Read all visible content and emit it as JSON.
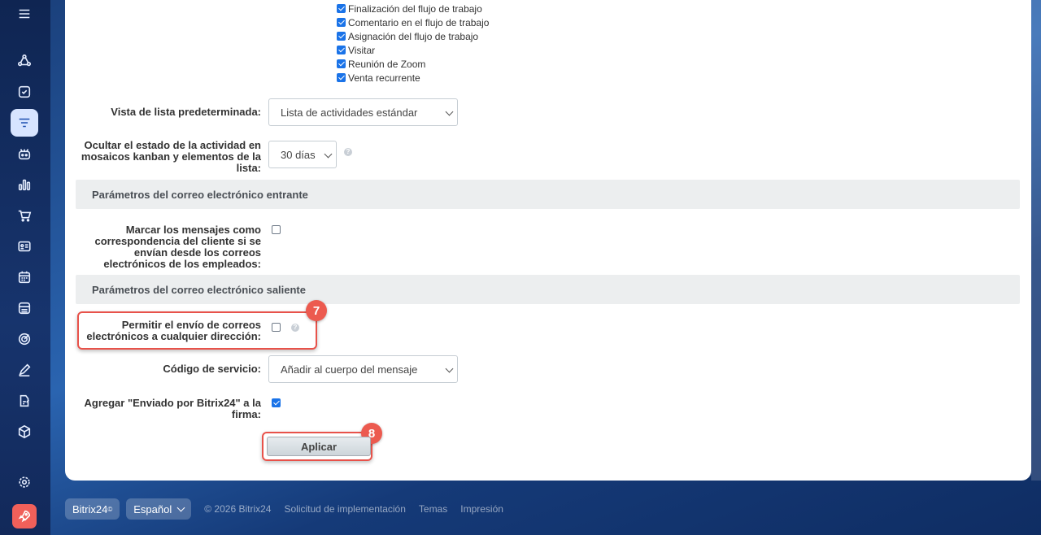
{
  "sidebar": {
    "icons": [
      "menu-icon",
      "share-network-icon",
      "checkbox-task-icon",
      "filter-funnel-icon",
      "robot-icon",
      "bar-chart-icon",
      "cart-icon",
      "contact-card-icon",
      "calendar-grid-icon",
      "store-icon",
      "target-icon",
      "pen-sign-icon",
      "document-edit-icon",
      "cube-icon",
      "settings-gear-icon",
      "rocket-icon"
    ]
  },
  "activity_types": [
    {
      "label": "Finalización del flujo de trabajo",
      "checked": true
    },
    {
      "label": "Comentario en el flujo de trabajo",
      "checked": true
    },
    {
      "label": "Asignación del flujo de trabajo",
      "checked": true
    },
    {
      "label": "Visitar",
      "checked": true
    },
    {
      "label": "Reunión de Zoom",
      "checked": true
    },
    {
      "label": "Venta recurrente",
      "checked": true
    }
  ],
  "default_list_view": {
    "label": "Vista de lista predeterminada:",
    "value": "Lista de actividades estándar"
  },
  "hide_status": {
    "label_line1": "Ocultar el estado de la actividad en",
    "label_line2": "mosaicos kanban y elementos de la",
    "label_line3": "lista:",
    "value": "30 días"
  },
  "incoming_section": {
    "title": "Parámetros del correo electrónico entrante",
    "mark_label_line1": "Marcar los mensajes como",
    "mark_label_line2": "correspondencia del cliente si se",
    "mark_label_line3": "envían desde los correos",
    "mark_label_line4": "electrónicos de los empleados:",
    "mark_checked": false
  },
  "outgoing_section": {
    "title": "Parámetros del correo electrónico saliente",
    "allow_label_line1": "Permitir el envío de correos",
    "allow_label_line2": "electrónicos a cualquier dirección:",
    "allow_checked": false,
    "service_code_label": "Código de servicio:",
    "service_code_value": "Añadir al cuerpo del mensaje",
    "signature_label_line1": "Agregar \"Enviado por Bitrix24\" a la",
    "signature_label_line2": "firma:",
    "signature_checked": true
  },
  "annotations": {
    "badge_7": "7",
    "badge_8": "8"
  },
  "apply_button": "Aplicar",
  "footer": {
    "brand": "Bitrix24",
    "brand_sup": "©",
    "language": "Español",
    "copyright": "© 2026 Bitrix24",
    "link_implementation": "Solicitud de implementación",
    "link_themes": "Temas",
    "link_print": "Impresión"
  },
  "colors": {
    "accent": "#1a73e8",
    "highlight": "#e8524a",
    "badge": "#ec5a4f"
  }
}
